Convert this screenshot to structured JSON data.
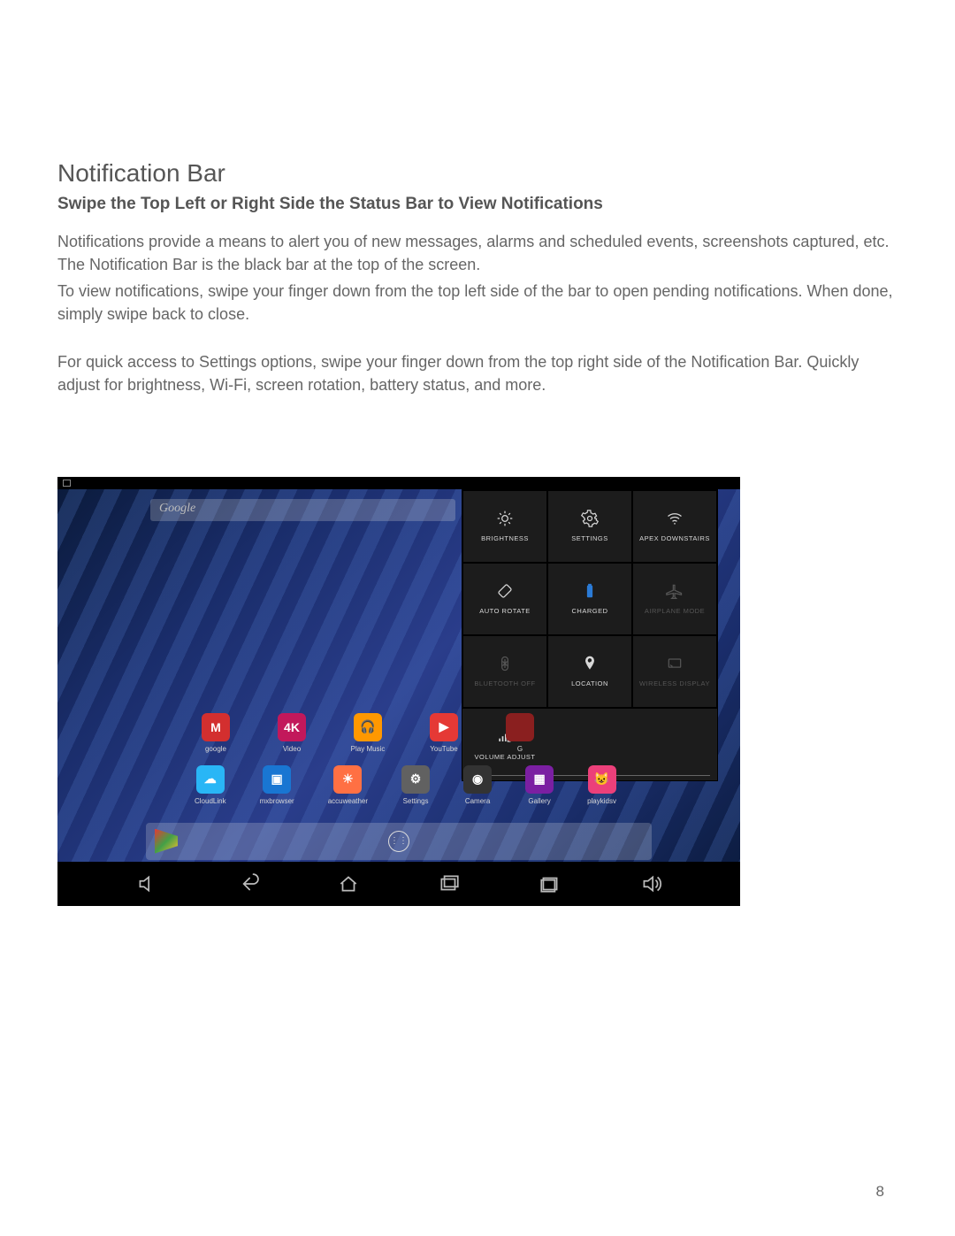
{
  "heading": "Notification Bar",
  "subheading": "Swipe the Top Left or Right Side the Status Bar to View Notifications",
  "para1": "Notifications provide a means to alert you of new messages, alarms and scheduled events, screenshots captured, etc. The Notification Bar is the black bar at the top of the screen.",
  "para2": "To view notifications, swipe your finger down from the top left side of the bar to open pending notifications. When done, simply swipe back to close.",
  "para3": "For quick access to Settings options, swipe your finger down from the top right side of the Notification Bar. Quickly adjust for brightness, Wi-Fi, screen rotation, battery status, and more.",
  "page_number": "8",
  "screenshot": {
    "search_placeholder": "Google",
    "quick_tiles": {
      "brightness": "BRIGHTNESS",
      "settings": "SETTINGS",
      "wifi": "APEX DOWNSTAIRS",
      "autorotate": "AUTO ROTATE",
      "charged": "CHARGED",
      "airplane": "AIRPLANE MODE",
      "bluetooth": "BLUETOOTH OFF",
      "location": "LOCATION",
      "wireless_display": "WIRELESS DISPLAY",
      "volume": "VOLUME ADJUST"
    },
    "apps_row1": [
      {
        "label": "google",
        "badge": "M",
        "bg": "#d32f2f"
      },
      {
        "label": "Video",
        "badge": "4K",
        "bg": "#c2185b"
      },
      {
        "label": "Play Music",
        "badge": "🎧",
        "bg": "#ff9800"
      },
      {
        "label": "YouTube",
        "badge": "▶",
        "bg": "#e53935"
      },
      {
        "label": "G",
        "badge": "",
        "bg": "#8a1f1f"
      }
    ],
    "apps_row2": [
      {
        "label": "CloudLink",
        "badge": "☁",
        "bg": "#29b6f6"
      },
      {
        "label": "mxbrowser",
        "badge": "▣",
        "bg": "#1976d2"
      },
      {
        "label": "accuweather",
        "badge": "☀",
        "bg": "#ff7043"
      },
      {
        "label": "Settings",
        "badge": "⚙",
        "bg": "#616161"
      },
      {
        "label": "Camera",
        "badge": "◉",
        "bg": "#333"
      },
      {
        "label": "Gallery",
        "badge": "▦",
        "bg": "#7b1fa2"
      },
      {
        "label": "playkidsv",
        "badge": "😺",
        "bg": "#ec407a"
      }
    ]
  }
}
